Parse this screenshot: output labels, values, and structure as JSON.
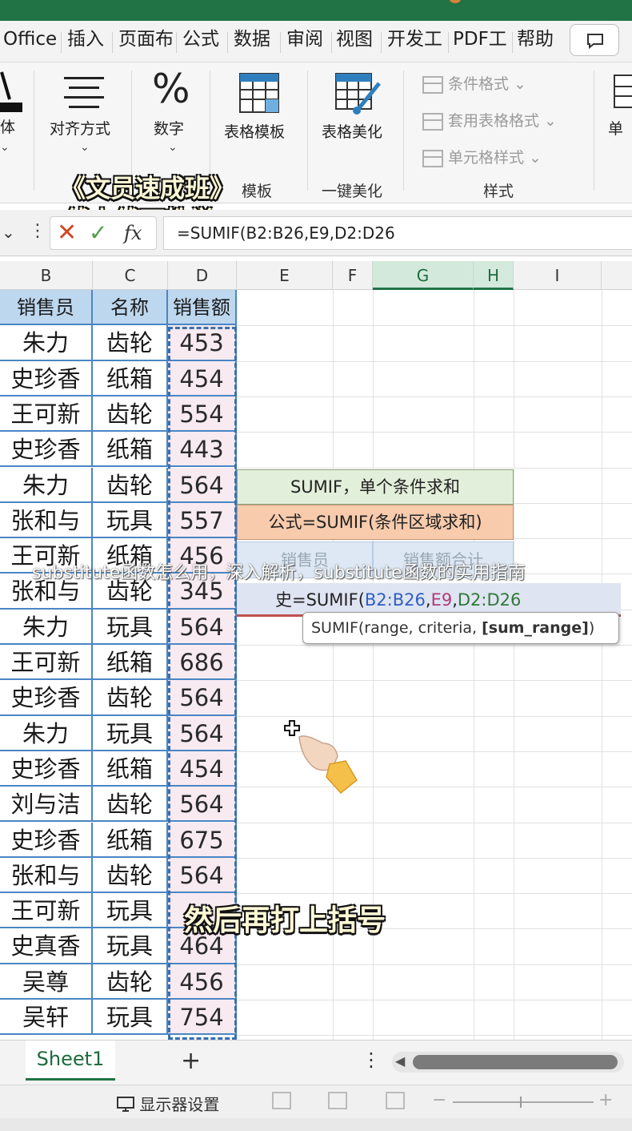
{
  "menu": {
    "tabs": [
      "Office",
      "插入",
      "页面布",
      "公式",
      "数据",
      "审阅",
      "视图",
      "开发工",
      "PDF工",
      "帮助"
    ]
  },
  "ribbon": {
    "font_label": "体",
    "align_label": "对齐方式",
    "number_label": "数字",
    "number_symbol": "%",
    "template_label": "表格模板",
    "beautify_label": "表格美化",
    "group_template": "模板",
    "group_beautify": "一键美化",
    "group_styles": "样式",
    "conditional_format": "条件格式",
    "table_format": "套用表格格式",
    "cell_style": "单元格样式",
    "cell_label": "单"
  },
  "banner": {
    "title": "《文员速成班》",
    "subtitle": "线上线下教学"
  },
  "formula_bar": {
    "fx": "fx",
    "formula": "=SUMIF(B2:B26,E9,D2:D26"
  },
  "columns": [
    "B",
    "C",
    "D",
    "E",
    "F",
    "G",
    "H",
    "I"
  ],
  "table": {
    "headers": [
      "销售员",
      "名称",
      "销售额"
    ],
    "rows": [
      [
        "朱力",
        "齿轮",
        "453"
      ],
      [
        "史珍香",
        "纸箱",
        "454"
      ],
      [
        "王可新",
        "齿轮",
        "554"
      ],
      [
        "史珍香",
        "纸箱",
        "443"
      ],
      [
        "朱力",
        "齿轮",
        "564"
      ],
      [
        "张和与",
        "玩具",
        "557"
      ],
      [
        "王可新",
        "纸箱",
        "456"
      ],
      [
        "张和与",
        "齿轮",
        "345"
      ],
      [
        "朱力",
        "玩具",
        "564"
      ],
      [
        "王可新",
        "纸箱",
        "686"
      ],
      [
        "史珍香",
        "齿轮",
        "564"
      ],
      [
        "朱力",
        "玩具",
        "564"
      ],
      [
        "史珍香",
        "纸箱",
        "454"
      ],
      [
        "刘与洁",
        "齿轮",
        "564"
      ],
      [
        "史珍香",
        "纸箱",
        "675"
      ],
      [
        "张和与",
        "齿轮",
        "564"
      ],
      [
        "王可新",
        "玩具",
        ""
      ],
      [
        "史真香",
        "玩具",
        "464"
      ],
      [
        "吴尊",
        "齿轮",
        "456"
      ],
      [
        "吴轩",
        "玩具",
        "754"
      ]
    ]
  },
  "sumif_box": {
    "title": "SUMIF，单个条件求和",
    "formula": "公式=SUMIF(条件区域求和)",
    "col1": "销售员",
    "col2": "销售额合计",
    "edit_prefix": "史",
    "edit_eq": "=SUMIF(",
    "edit_r1": "B2:B26",
    "edit_c1": ",",
    "edit_r2": "E9",
    "edit_c2": ",",
    "edit_r3": "D2:D26"
  },
  "tooltip": {
    "fn": "SUMIF(range, criteria, ",
    "opt": "[sum_range]",
    "close": ")"
  },
  "overlay_caption": "substitute函数怎么用，深入解析，substitute函数的实用指南",
  "bottom_caption": "然后再打上括号",
  "sheets": {
    "active": "Sheet1",
    "add": "+"
  },
  "status": {
    "display_settings": "显示器设置"
  },
  "colors": {
    "excel_green": "#217346",
    "header_blue": "#bdd7ee",
    "sumif_green": "#e2efda",
    "sumif_orange": "#f8cbad"
  }
}
